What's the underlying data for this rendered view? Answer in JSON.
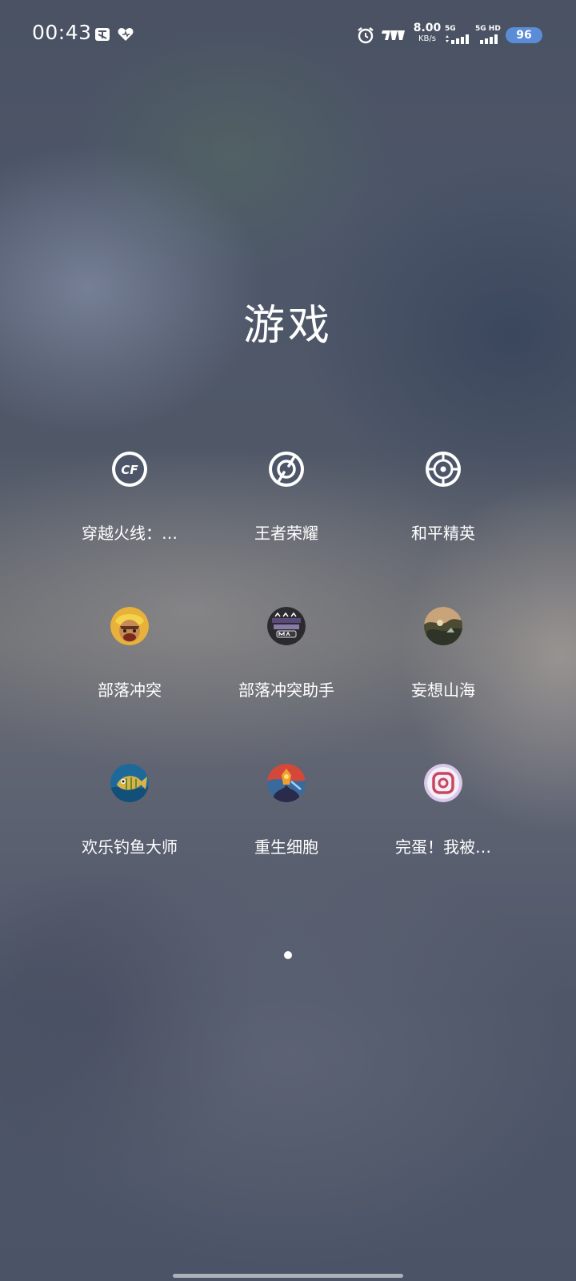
{
  "status_bar": {
    "time": "00:43",
    "net_speed_value": "8.00",
    "net_speed_unit": "KB/s",
    "sim1_label": "5G",
    "sim2_label": "5G HD",
    "battery": "96",
    "icons": [
      "text-notification-icon",
      "heart-icon",
      "alarm-icon",
      "carrier-logo-icon",
      "signal-icon",
      "signal-icon"
    ]
  },
  "folder": {
    "title": "游戏"
  },
  "apps": [
    {
      "label": "穿越火线：…",
      "icon": "crossfire-cf-icon"
    },
    {
      "label": "王者荣耀",
      "icon": "honor-of-kings-icon"
    },
    {
      "label": "和平精英",
      "icon": "crosshair-target-icon"
    },
    {
      "label": "部落冲突",
      "icon": "clash-of-clans-icon"
    },
    {
      "label": "部落冲突助手",
      "icon": "clash-helper-icon"
    },
    {
      "label": "妄想山海",
      "icon": "mountains-seas-icon"
    },
    {
      "label": "欢乐钓鱼大师",
      "icon": "fishing-master-icon"
    },
    {
      "label": "重生细胞",
      "icon": "dead-cells-icon"
    },
    {
      "label": "完蛋！我被…",
      "icon": "game-app-icon"
    }
  ],
  "pagination": {
    "pages": 1,
    "current": 1
  }
}
